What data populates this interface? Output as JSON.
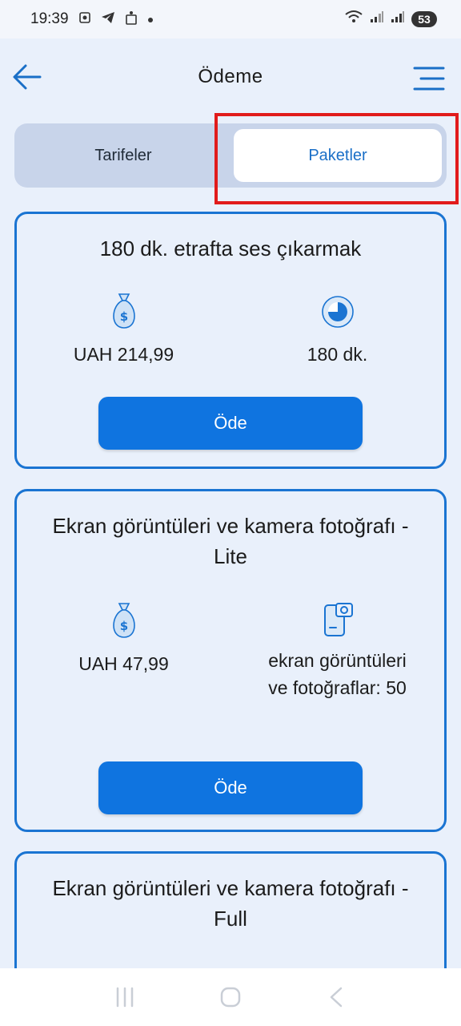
{
  "status_bar": {
    "time": "19:39",
    "icons": [
      "screenshot-icon",
      "telegram-icon",
      "notification-icon",
      "dot-icon"
    ],
    "battery": "53"
  },
  "header": {
    "title": "Ödeme",
    "back_icon": "arrow-left-icon",
    "menu_icon": "menu-icon"
  },
  "tabs": [
    {
      "label": "Tarifeler",
      "active": false
    },
    {
      "label": "Paketler",
      "active": true
    }
  ],
  "cards": [
    {
      "title": "180 dk. etrafta ses çıkarmak",
      "price_icon": "money-bag-icon",
      "price": "UAH 214,99",
      "feature_icon": "clock-icon",
      "feature": "180 dk.",
      "button": "Öde"
    },
    {
      "title": "Ekran görüntüleri ve kamera fotoğrafı - Lite",
      "price_icon": "money-bag-icon",
      "price": "UAH 47,99",
      "feature_icon": "phone-camera-icon",
      "feature": "ekran görüntüleri ve fotoğraflar: 50",
      "button": "Öde"
    },
    {
      "title": "Ekran görüntüleri ve kamera fotoğrafı - Full"
    }
  ],
  "colors": {
    "accent": "#0f74e0",
    "card_border": "#1a74d2",
    "background": "#e9f0fb",
    "tab_bg": "#c8d4ea",
    "highlight": "#e11b1b"
  }
}
